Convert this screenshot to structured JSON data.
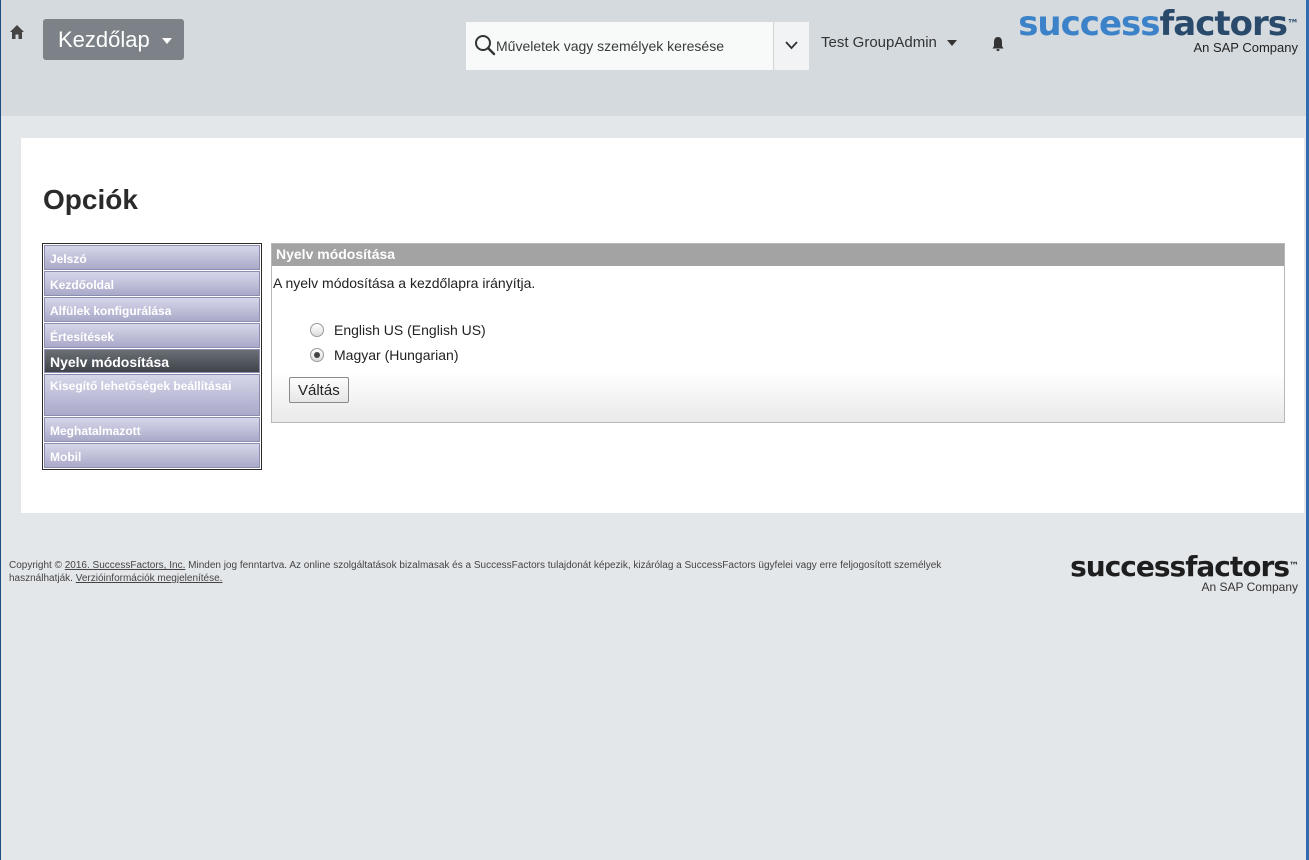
{
  "header": {
    "home_label": "Kezdőlap",
    "search_placeholder": "Műveletek vagy személyek keresése",
    "user_name": "Test GroupAdmin",
    "logo_part1": "success",
    "logo_part2": "factors",
    "logo_tm": "™",
    "logo_sub": "An SAP Company"
  },
  "page": {
    "title": "Opciók"
  },
  "sidebar": {
    "items": [
      {
        "label": "Jelszó"
      },
      {
        "label": "Kezdőoldal"
      },
      {
        "label": "Alfülek konfigurálása"
      },
      {
        "label": "Értesítések"
      },
      {
        "label": "Nyelv módosítása"
      },
      {
        "label": "Kisegítő lehetőségek beállításai"
      },
      {
        "label": "Meghatalmazott"
      },
      {
        "label": "Mobil"
      }
    ],
    "active_index": 4
  },
  "content": {
    "header": "Nyelv módosítása",
    "description": "A nyelv módosítása a kezdőlapra irányítja.",
    "options": [
      {
        "label": "English US (English US)",
        "selected": false
      },
      {
        "label": "Magyar (Hungarian)",
        "selected": true
      }
    ],
    "submit_label": "Váltás"
  },
  "footer": {
    "copyright_prefix": "Copyright © ",
    "company_link": "2016. SuccessFactors, Inc.",
    "text_after_link": " Minden jog fenntartva. Az online szolgáltatások bizalmasak és a SuccessFactors tulajdonát képezik, kizárólag a SuccessFactors ügyfelei vagy erre feljogosított személyek használhatják. ",
    "version_link": "Verzióinformációk megjelenítése.",
    "logo_part1": "success",
    "logo_part2": "factors",
    "logo_tm": "™",
    "logo_sub": "An SAP Company"
  }
}
